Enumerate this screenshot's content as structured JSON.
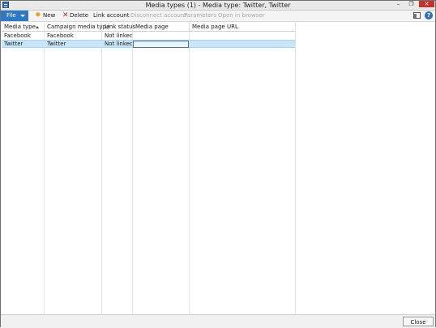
{
  "window": {
    "title": "Media types (1) - Media type: Twitter, Twitter",
    "controls": {
      "minimize": "–",
      "maximize": "❐",
      "close": "✕"
    }
  },
  "toolbar": {
    "file_label": "File",
    "new_label": "New",
    "delete_label": "Delete",
    "link_account_label": "Link account",
    "disconnect_account_label": "Disconnect account",
    "parameters_label": "Parameters",
    "open_in_browser_label": "Open in browser",
    "help_label": "?"
  },
  "grid": {
    "columns": [
      "Media type",
      "Campaign media type",
      "Link status",
      "Media page",
      "Media page URL"
    ],
    "rows": [
      {
        "media_type": "Facebook",
        "campaign_media_type": "Facebook",
        "link_status": "Not linked",
        "media_page": "",
        "media_page_url": ""
      },
      {
        "media_type": "Twitter",
        "campaign_media_type": "Twitter",
        "link_status": "Not linked",
        "media_page": "",
        "media_page_url": "",
        "selected": true
      }
    ]
  },
  "footer": {
    "close_label": "Close"
  },
  "colors": {
    "file_button": "#2f78c4",
    "selected_row": "#c9e6f8",
    "close_control": "#c7302b",
    "disabled_text": "#a9a9a9"
  },
  "icons": [
    "app-icon",
    "new-star-icon",
    "delete-x-icon",
    "sort-ascending-icon",
    "layout-icon",
    "help-icon"
  ]
}
